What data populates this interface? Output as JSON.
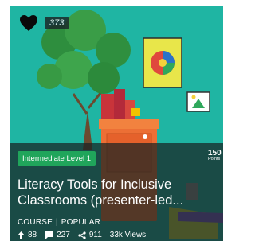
{
  "card": {
    "likes": "373",
    "level": "Intermediate Level 1",
    "points": {
      "value": "150",
      "label": "Points"
    },
    "title": "Literacy Tools for Inclusive Classrooms (presenter-led...",
    "type": "COURSE",
    "separator": "|",
    "tag": "POPULAR",
    "stats": {
      "upvotes": "88",
      "comments": "227",
      "shares": "911",
      "views": "33k Views"
    },
    "colors": {
      "background": "#1fb5a3",
      "level_badge": "#20a55b"
    }
  }
}
